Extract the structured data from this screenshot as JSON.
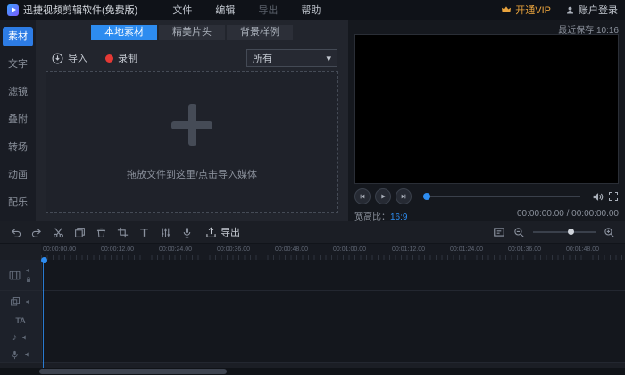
{
  "titlebar": {
    "app_title": "迅捷视频剪辑软件(免费版)",
    "menu_file": "文件",
    "menu_edit": "编辑",
    "menu_export": "导出",
    "menu_help": "帮助",
    "vip_label": "开通VIP",
    "login_label": "账户登录"
  },
  "sidebar": {
    "active_index": 0,
    "items": [
      {
        "label": "素材"
      },
      {
        "label": "文字"
      },
      {
        "label": "滤镜"
      },
      {
        "label": "叠附"
      },
      {
        "label": "转场"
      },
      {
        "label": "动画"
      },
      {
        "label": "配乐"
      }
    ]
  },
  "media": {
    "tabs": [
      {
        "label": "本地素材"
      },
      {
        "label": "精美片头"
      },
      {
        "label": "背景样例"
      }
    ],
    "import_label": "导入",
    "record_label": "录制",
    "filter_value": "所有",
    "dropdown_caret": "▾",
    "drop_hint": "拖放文件到这里/点击导入媒体"
  },
  "preview": {
    "last_saved": "最近保存 10:16",
    "aspect_label": "宽高比：",
    "aspect_value": "16:9",
    "timecode": "00:00:00.00 / 00:00:00.00"
  },
  "timeline": {
    "export_label": "导出",
    "ruler_labels": [
      "00:00:00.00",
      "00:00:12.00",
      "00:00:24.00",
      "00:00:36.00",
      "00:00:48.00",
      "00:01:00.00",
      "00:01:12.00",
      "00:01:24.00",
      "00:01:36.00",
      "00:01:48.00"
    ],
    "text_track_glyph": "TA",
    "music_track_glyph": "♪"
  },
  "colors": {
    "accent": "#2d8cf0",
    "vip": "#e8a33d",
    "record": "#e53935"
  }
}
